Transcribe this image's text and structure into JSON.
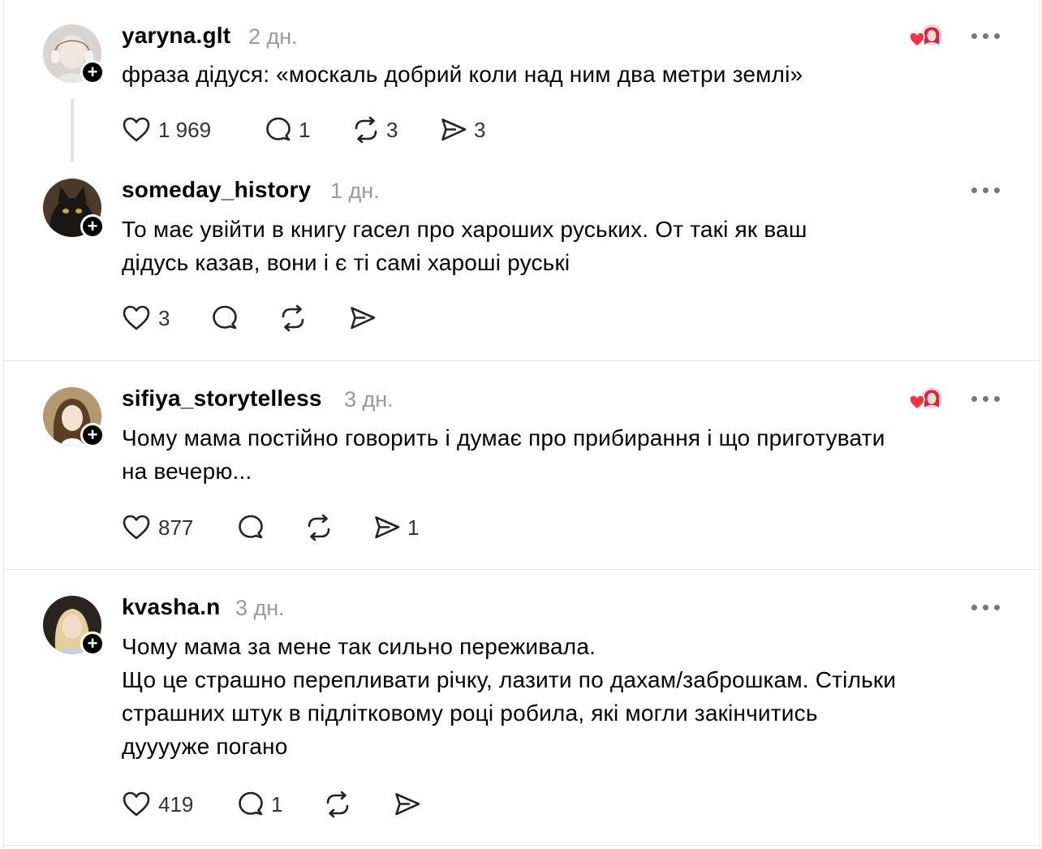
{
  "posts": [
    {
      "username": "yaryna.glt",
      "time": "2 дн.",
      "text": "фраза дідуся: «москаль добрий коли над ним два метри землі»",
      "likes": "1 969",
      "replies": "1",
      "reposts": "3",
      "shares": "3"
    },
    {
      "username": "someday_history",
      "time": "1 дн.",
      "text": "То має увійти в книгу гасел про хароших руських. От такі як ваш\nдідусь казав, вони і є ті самі хароші руські",
      "likes": "3",
      "replies": "",
      "reposts": "",
      "shares": ""
    },
    {
      "username": "sifiya_storytelless",
      "time": "3 дн.",
      "text": "Чому мама постійно говорить і думає про прибирання і що приготувати\nна вечерю...",
      "likes": "877",
      "replies": "",
      "reposts": "",
      "shares": "1"
    },
    {
      "username": "kvasha.n",
      "time": "3 дн.",
      "text": "Чому мама за мене так сильно переживала.\nЩо це страшно перепливати річку, лазити по дахам/заброшкам. Стільки\nстрашних штук в підлітковому році робила, які могли закінчитись\nдууууже погано",
      "likes": "419",
      "replies": "1",
      "reposts": "",
      "shares": ""
    }
  ],
  "icons": {
    "like": "heart-outline-icon",
    "reply": "speech-bubble-icon",
    "repost": "repost-arrows-icon",
    "share": "paper-plane-icon",
    "more": "three-dots-icon",
    "follow": "plus-icon",
    "liked_by": "heart-filled-icon"
  },
  "colors": {
    "text": "#000000",
    "secondary": "#999999",
    "icon": "#333333",
    "heart_red": "#ff3040",
    "divider": "#e6e6e6"
  }
}
